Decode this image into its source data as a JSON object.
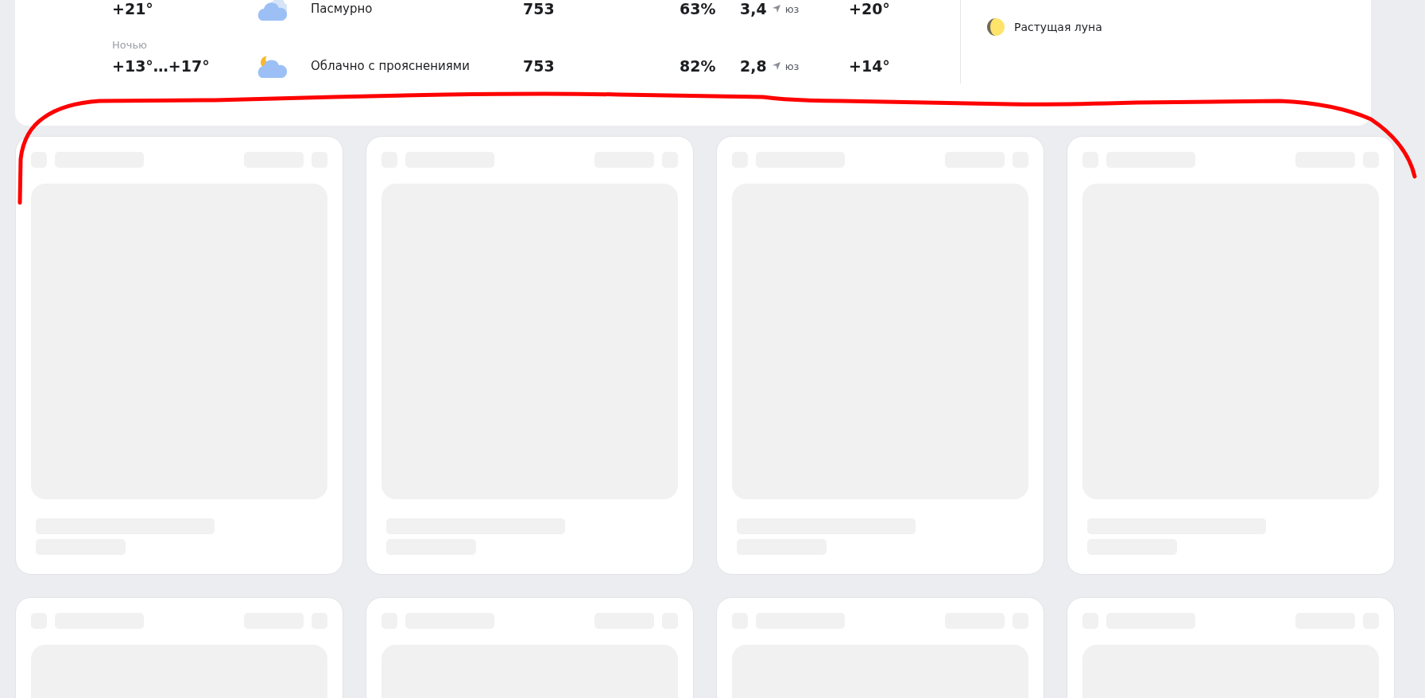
{
  "forecast": {
    "rows": [
      {
        "temperature": "+21°",
        "kind": "overcast",
        "condition": "Пасмурно",
        "pressure": "753",
        "humidity": "63%",
        "wind_speed": "3,4",
        "wind_direction": "юз",
        "feels_like": "+20°"
      },
      {
        "label": "Ночью",
        "temperature": "+13°…+17°",
        "kind": "partly-cloudy-night",
        "condition": "Облачно с прояснениями",
        "pressure": "753",
        "humidity": "82%",
        "wind_speed": "2,8",
        "wind_direction": "юз",
        "feels_like": "+14°"
      }
    ],
    "moon": {
      "kind": "waxing",
      "text": "Растущая луна"
    }
  },
  "feed": [
    {
      "kind": "placeholder"
    },
    {
      "kind": "placeholder"
    },
    {
      "kind": "placeholder"
    },
    {
      "kind": "placeholder"
    },
    {
      "kind": "placeholder-cut"
    },
    {
      "kind": "placeholder-cut"
    },
    {
      "kind": "placeholder-cut"
    },
    {
      "kind": "placeholder-cut"
    }
  ],
  "annotation": {
    "kind": "freehand-stroke"
  }
}
